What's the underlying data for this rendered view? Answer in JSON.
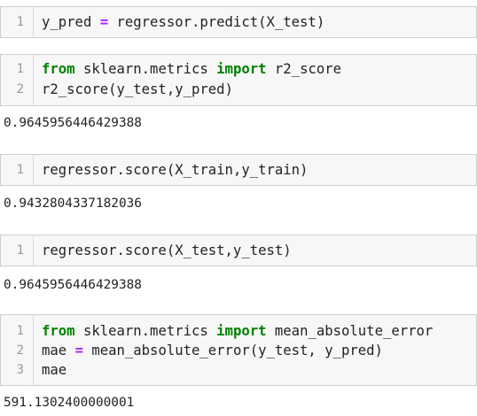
{
  "cells": [
    {
      "line_numbers": [
        "1"
      ],
      "code": [
        {
          "a": "y_pred ",
          "op": "=",
          "b": " regressor.predict(X_test)"
        }
      ],
      "output": ""
    },
    {
      "line_numbers": [
        "1",
        "2"
      ],
      "code": [
        {
          "kw1": "from",
          "a": " sklearn.metrics ",
          "kw2": "import",
          "b": " r2_score"
        },
        {
          "a": "r2_score(y_test,y_pred)"
        }
      ],
      "output": "0.9645956446429388"
    },
    {
      "line_numbers": [
        "1"
      ],
      "code": [
        {
          "a": "regressor.score(X_train,y_train)"
        }
      ],
      "output": "0.9432804337182036"
    },
    {
      "line_numbers": [
        "1"
      ],
      "code": [
        {
          "a": "regressor.score(X_test,y_test)"
        }
      ],
      "output": "0.9645956446429388"
    },
    {
      "line_numbers": [
        "1",
        "2",
        "3"
      ],
      "code": [
        {
          "kw1": "from",
          "a": " sklearn.metrics ",
          "kw2": "import",
          "b": " mean_absolute_error"
        },
        {
          "a": "mae ",
          "op": "=",
          "b": " mean_absolute_error(y_test, y_pred)"
        },
        {
          "a": "mae"
        }
      ],
      "output": "591.1302400000001"
    }
  ]
}
